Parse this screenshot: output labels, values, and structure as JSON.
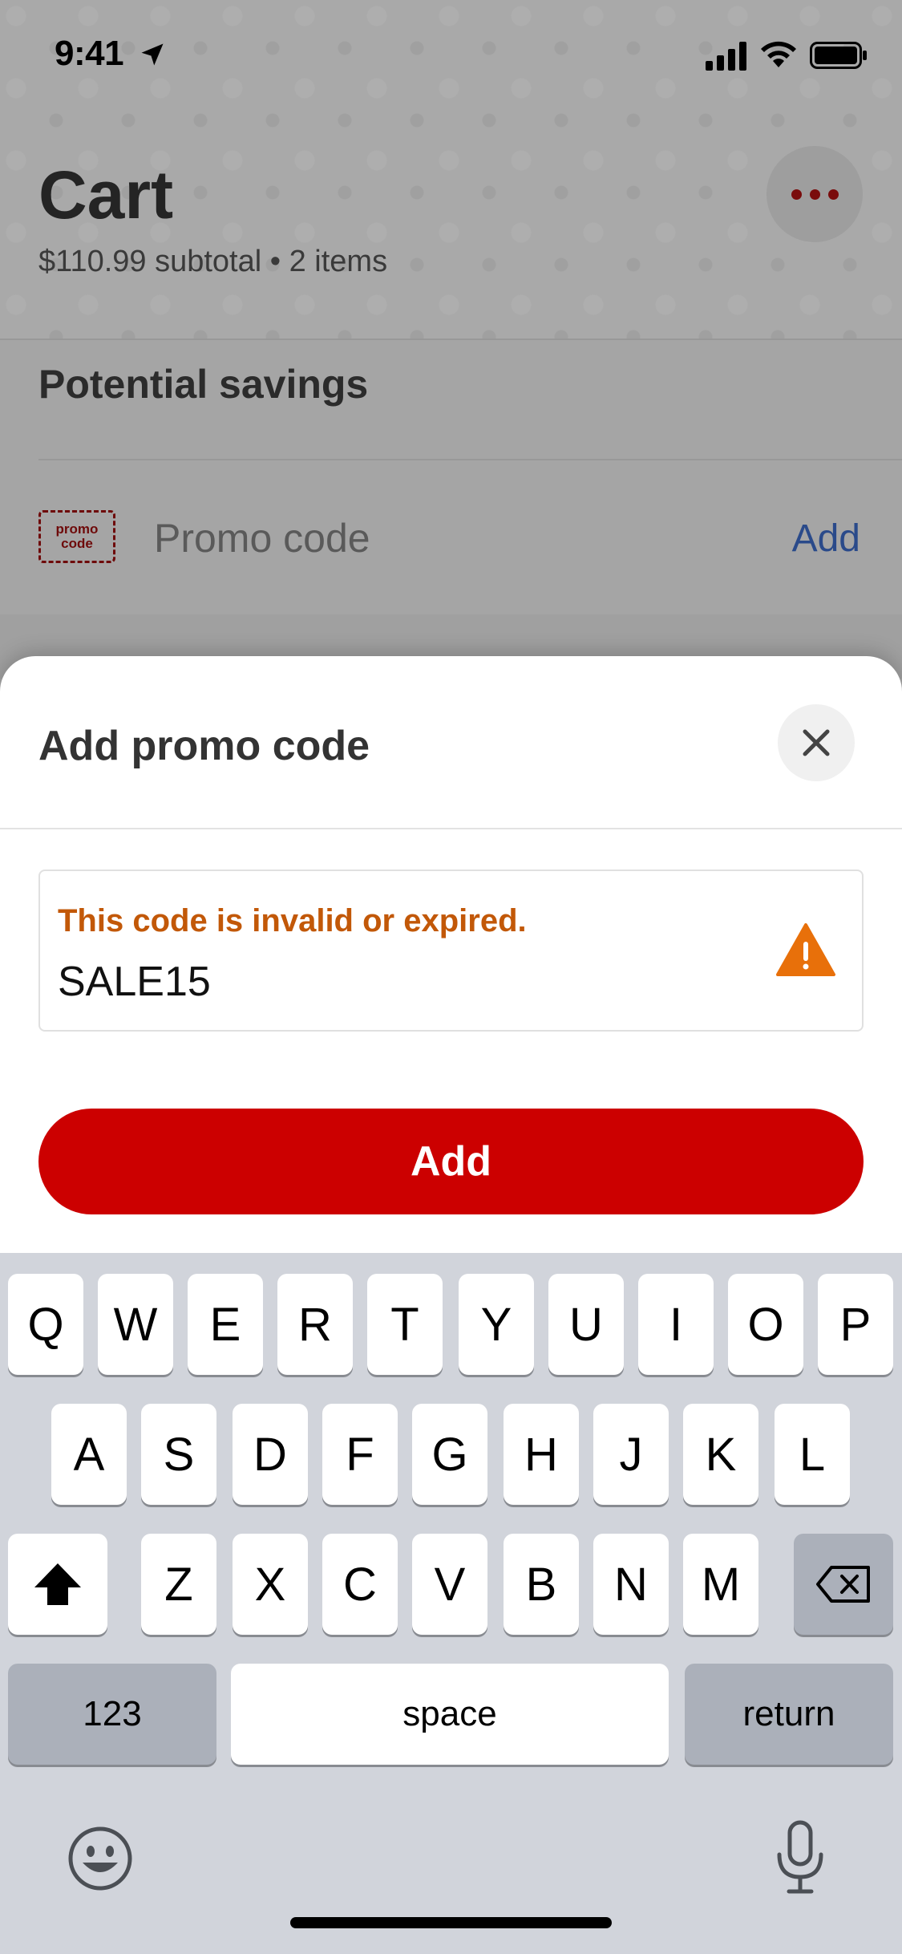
{
  "status_bar": {
    "time": "9:41"
  },
  "cart": {
    "title": "Cart",
    "subtitle": "$110.99 subtotal • 2 items",
    "more_icon": "more-horizontal-icon"
  },
  "savings": {
    "title": "Potential savings",
    "promo_badge_line1": "promo",
    "promo_badge_line2": "code",
    "promo_label": "Promo code",
    "promo_add": "Add"
  },
  "sheet": {
    "title": "Add promo code",
    "close_icon": "close-icon",
    "input": {
      "error": "This code is invalid or expired.",
      "value": "SALE15",
      "warning_icon": "warning-triangle-icon"
    },
    "add_button": "Add"
  },
  "keyboard": {
    "row1": [
      "Q",
      "W",
      "E",
      "R",
      "T",
      "Y",
      "U",
      "I",
      "O",
      "P"
    ],
    "row2": [
      "A",
      "S",
      "D",
      "F",
      "G",
      "H",
      "J",
      "K",
      "L"
    ],
    "row3": [
      "Z",
      "X",
      "C",
      "V",
      "B",
      "N",
      "M"
    ],
    "numbers": "123",
    "space": "space",
    "return": "return",
    "shift_icon": "shift-icon",
    "delete_icon": "delete-icon",
    "emoji_icon": "emoji-icon",
    "mic_icon": "microphone-icon"
  },
  "colors": {
    "accent_red": "#cc0000",
    "error_orange": "#c25808",
    "link_blue": "#2a4a8a"
  }
}
